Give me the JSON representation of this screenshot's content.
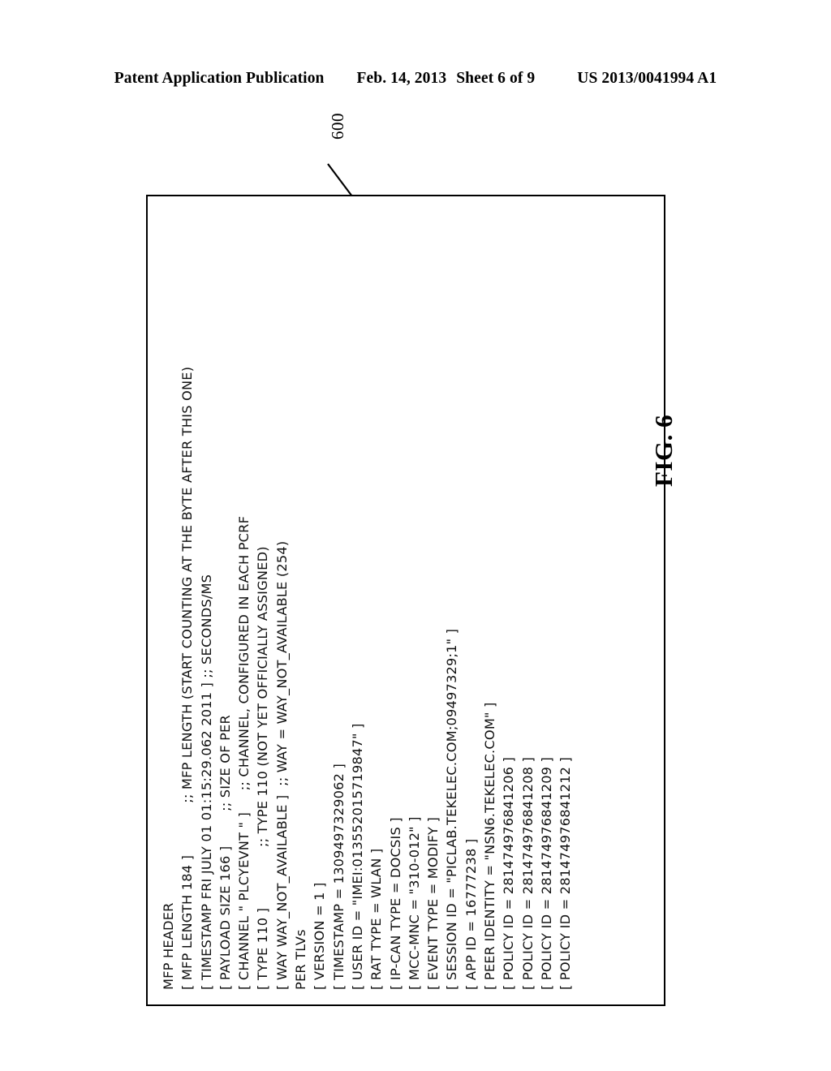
{
  "header": {
    "publication": "Patent Application Publication",
    "date": "Feb. 14, 2013",
    "sheet": "Sheet 6 of 9",
    "number": "US 2013/0041994 A1"
  },
  "figure": {
    "label": "FIG. 6",
    "reference_numeral": "600"
  },
  "listing": {
    "lines": [
      "MFP HEADER",
      "[ MFP LENGTH 184 ]            ;; MFP LENGTH (START COUNTING AT THE BYTE AFTER THIS ONE)",
      "[ TIMESTAMP FRI JULY 01 01:15:29.062 2011 ] ;; SECONDS/MS",
      "[ PAYLOAD SIZE 166 ]        ;; SIZE OF PER",
      "[ CHANNEL \" PLCYEVNT \" ]     ;; CHANNEL, CONFIGURED IN EACH PCRF",
      "[ TYPE 110 ]              ;; TYPE 110 (NOT YET OFFICIALLY ASSIGNED)",
      "[ WAY WAY_NOT_AVAILABLE ]  ;; WAY = WAY_NOT_AVAILABLE (254)",
      "PER TLVs",
      "[ VERSION = 1 ]",
      "[ TIMESTAMP = 1309497329062 ]",
      "[ USER ID = \"IMEI:013552015719847\" ]",
      "[ RAT TYPE = WLAN ]",
      "[ IP-CAN TYPE = DOCSIS ]",
      "[ MCC-MNC = \"310-012\" ]",
      "[ EVENT TYPE = MODIFY ]",
      "[ SESSION ID = \"PICLAB.TEKELEC.COM;09497329;1\" ]",
      "[ APP ID = 16777238 ]",
      "[ PEER IDENTITY = \"NSN6.TEKELEC.COM\" ]",
      "[ POLICY ID = 281474976841206 ]",
      "[ POLICY ID = 281474976841208 ]",
      "[ POLICY ID = 281474976841209 ]",
      "[ POLICY ID = 281474976841212 ]"
    ]
  },
  "colors": {
    "ink": "#000000",
    "paper": "#ffffff"
  }
}
